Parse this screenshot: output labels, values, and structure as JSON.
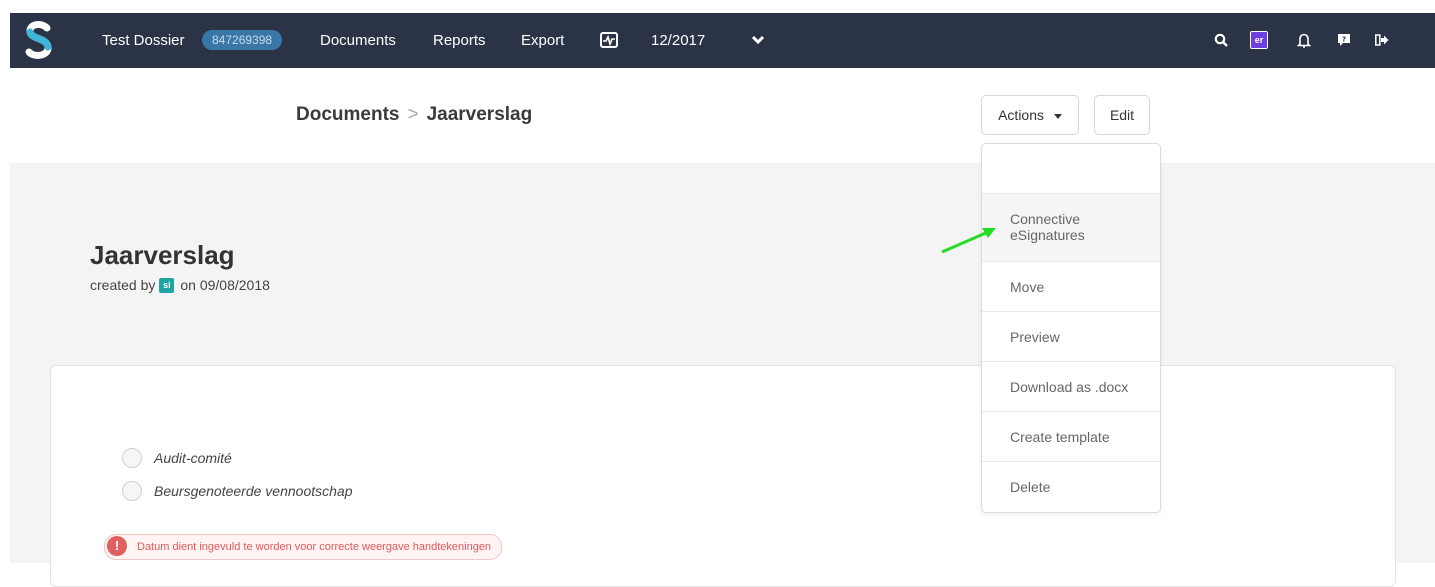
{
  "nav": {
    "dossier_name": "Test Dossier",
    "dossier_id": "847269398",
    "documents": "Documents",
    "reports": "Reports",
    "export": "Export",
    "period": "12/2017",
    "user_badge": "er"
  },
  "breadcrumb": {
    "parent": "Documents",
    "separator": ">",
    "current": "Jaarverslag"
  },
  "toolbar": {
    "actions_label": "Actions",
    "edit_label": "Edit"
  },
  "document": {
    "title": "Jaarverslag",
    "created_by_prefix": "created by",
    "author_badge": "si",
    "created_on": "on 09/08/2018"
  },
  "options": [
    {
      "label": "Audit-comité"
    },
    {
      "label": "Beursgenoteerde vennootschap"
    }
  ],
  "warning": {
    "icon": "!",
    "text": "Datum dient ingevuld te worden voor correcte weergave handtekeningen"
  },
  "actions_menu": [
    {
      "label": "Connective\neSignatures"
    },
    {
      "label": "Move"
    },
    {
      "label": "Preview"
    },
    {
      "label": "Download as .docx"
    },
    {
      "label": "Create template"
    },
    {
      "label": "Delete"
    }
  ],
  "colors": {
    "nav_bg": "#2a3446",
    "accent_teal": "#1fa4a6",
    "badge_purple": "#6b3fe0",
    "warning_red": "#e05a5a",
    "arrow_green": "#22dd22"
  }
}
